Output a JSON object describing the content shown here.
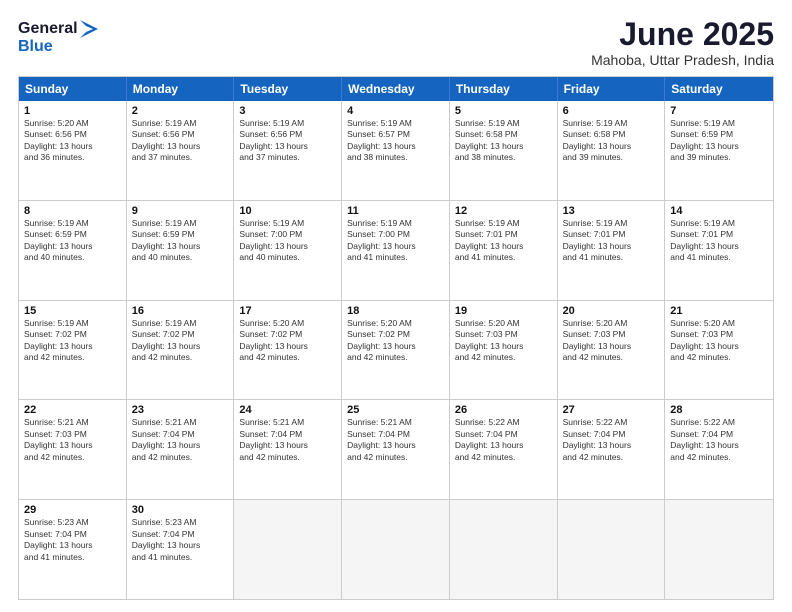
{
  "header": {
    "logo_general": "General",
    "logo_blue": "Blue",
    "month_title": "June 2025",
    "location": "Mahoba, Uttar Pradesh, India"
  },
  "weekdays": [
    "Sunday",
    "Monday",
    "Tuesday",
    "Wednesday",
    "Thursday",
    "Friday",
    "Saturday"
  ],
  "rows": [
    [
      {
        "day": "1",
        "lines": [
          "Sunrise: 5:20 AM",
          "Sunset: 6:56 PM",
          "Daylight: 13 hours",
          "and 36 minutes."
        ]
      },
      {
        "day": "2",
        "lines": [
          "Sunrise: 5:19 AM",
          "Sunset: 6:56 PM",
          "Daylight: 13 hours",
          "and 37 minutes."
        ]
      },
      {
        "day": "3",
        "lines": [
          "Sunrise: 5:19 AM",
          "Sunset: 6:56 PM",
          "Daylight: 13 hours",
          "and 37 minutes."
        ]
      },
      {
        "day": "4",
        "lines": [
          "Sunrise: 5:19 AM",
          "Sunset: 6:57 PM",
          "Daylight: 13 hours",
          "and 38 minutes."
        ]
      },
      {
        "day": "5",
        "lines": [
          "Sunrise: 5:19 AM",
          "Sunset: 6:58 PM",
          "Daylight: 13 hours",
          "and 38 minutes."
        ]
      },
      {
        "day": "6",
        "lines": [
          "Sunrise: 5:19 AM",
          "Sunset: 6:58 PM",
          "Daylight: 13 hours",
          "and 39 minutes."
        ]
      },
      {
        "day": "7",
        "lines": [
          "Sunrise: 5:19 AM",
          "Sunset: 6:59 PM",
          "Daylight: 13 hours",
          "and 39 minutes."
        ]
      }
    ],
    [
      {
        "day": "8",
        "lines": [
          "Sunrise: 5:19 AM",
          "Sunset: 6:59 PM",
          "Daylight: 13 hours",
          "and 40 minutes."
        ]
      },
      {
        "day": "9",
        "lines": [
          "Sunrise: 5:19 AM",
          "Sunset: 6:59 PM",
          "Daylight: 13 hours",
          "and 40 minutes."
        ]
      },
      {
        "day": "10",
        "lines": [
          "Sunrise: 5:19 AM",
          "Sunset: 7:00 PM",
          "Daylight: 13 hours",
          "and 40 minutes."
        ]
      },
      {
        "day": "11",
        "lines": [
          "Sunrise: 5:19 AM",
          "Sunset: 7:00 PM",
          "Daylight: 13 hours",
          "and 41 minutes."
        ]
      },
      {
        "day": "12",
        "lines": [
          "Sunrise: 5:19 AM",
          "Sunset: 7:01 PM",
          "Daylight: 13 hours",
          "and 41 minutes."
        ]
      },
      {
        "day": "13",
        "lines": [
          "Sunrise: 5:19 AM",
          "Sunset: 7:01 PM",
          "Daylight: 13 hours",
          "and 41 minutes."
        ]
      },
      {
        "day": "14",
        "lines": [
          "Sunrise: 5:19 AM",
          "Sunset: 7:01 PM",
          "Daylight: 13 hours",
          "and 41 minutes."
        ]
      }
    ],
    [
      {
        "day": "15",
        "lines": [
          "Sunrise: 5:19 AM",
          "Sunset: 7:02 PM",
          "Daylight: 13 hours",
          "and 42 minutes."
        ]
      },
      {
        "day": "16",
        "lines": [
          "Sunrise: 5:19 AM",
          "Sunset: 7:02 PM",
          "Daylight: 13 hours",
          "and 42 minutes."
        ]
      },
      {
        "day": "17",
        "lines": [
          "Sunrise: 5:20 AM",
          "Sunset: 7:02 PM",
          "Daylight: 13 hours",
          "and 42 minutes."
        ]
      },
      {
        "day": "18",
        "lines": [
          "Sunrise: 5:20 AM",
          "Sunset: 7:02 PM",
          "Daylight: 13 hours",
          "and 42 minutes."
        ]
      },
      {
        "day": "19",
        "lines": [
          "Sunrise: 5:20 AM",
          "Sunset: 7:03 PM",
          "Daylight: 13 hours",
          "and 42 minutes."
        ]
      },
      {
        "day": "20",
        "lines": [
          "Sunrise: 5:20 AM",
          "Sunset: 7:03 PM",
          "Daylight: 13 hours",
          "and 42 minutes."
        ]
      },
      {
        "day": "21",
        "lines": [
          "Sunrise: 5:20 AM",
          "Sunset: 7:03 PM",
          "Daylight: 13 hours",
          "and 42 minutes."
        ]
      }
    ],
    [
      {
        "day": "22",
        "lines": [
          "Sunrise: 5:21 AM",
          "Sunset: 7:03 PM",
          "Daylight: 13 hours",
          "and 42 minutes."
        ]
      },
      {
        "day": "23",
        "lines": [
          "Sunrise: 5:21 AM",
          "Sunset: 7:04 PM",
          "Daylight: 13 hours",
          "and 42 minutes."
        ]
      },
      {
        "day": "24",
        "lines": [
          "Sunrise: 5:21 AM",
          "Sunset: 7:04 PM",
          "Daylight: 13 hours",
          "and 42 minutes."
        ]
      },
      {
        "day": "25",
        "lines": [
          "Sunrise: 5:21 AM",
          "Sunset: 7:04 PM",
          "Daylight: 13 hours",
          "and 42 minutes."
        ]
      },
      {
        "day": "26",
        "lines": [
          "Sunrise: 5:22 AM",
          "Sunset: 7:04 PM",
          "Daylight: 13 hours",
          "and 42 minutes."
        ]
      },
      {
        "day": "27",
        "lines": [
          "Sunrise: 5:22 AM",
          "Sunset: 7:04 PM",
          "Daylight: 13 hours",
          "and 42 minutes."
        ]
      },
      {
        "day": "28",
        "lines": [
          "Sunrise: 5:22 AM",
          "Sunset: 7:04 PM",
          "Daylight: 13 hours",
          "and 42 minutes."
        ]
      }
    ],
    [
      {
        "day": "29",
        "lines": [
          "Sunrise: 5:23 AM",
          "Sunset: 7:04 PM",
          "Daylight: 13 hours",
          "and 41 minutes."
        ]
      },
      {
        "day": "30",
        "lines": [
          "Sunrise: 5:23 AM",
          "Sunset: 7:04 PM",
          "Daylight: 13 hours",
          "and 41 minutes."
        ]
      },
      {
        "day": "",
        "lines": []
      },
      {
        "day": "",
        "lines": []
      },
      {
        "day": "",
        "lines": []
      },
      {
        "day": "",
        "lines": []
      },
      {
        "day": "",
        "lines": []
      }
    ]
  ]
}
